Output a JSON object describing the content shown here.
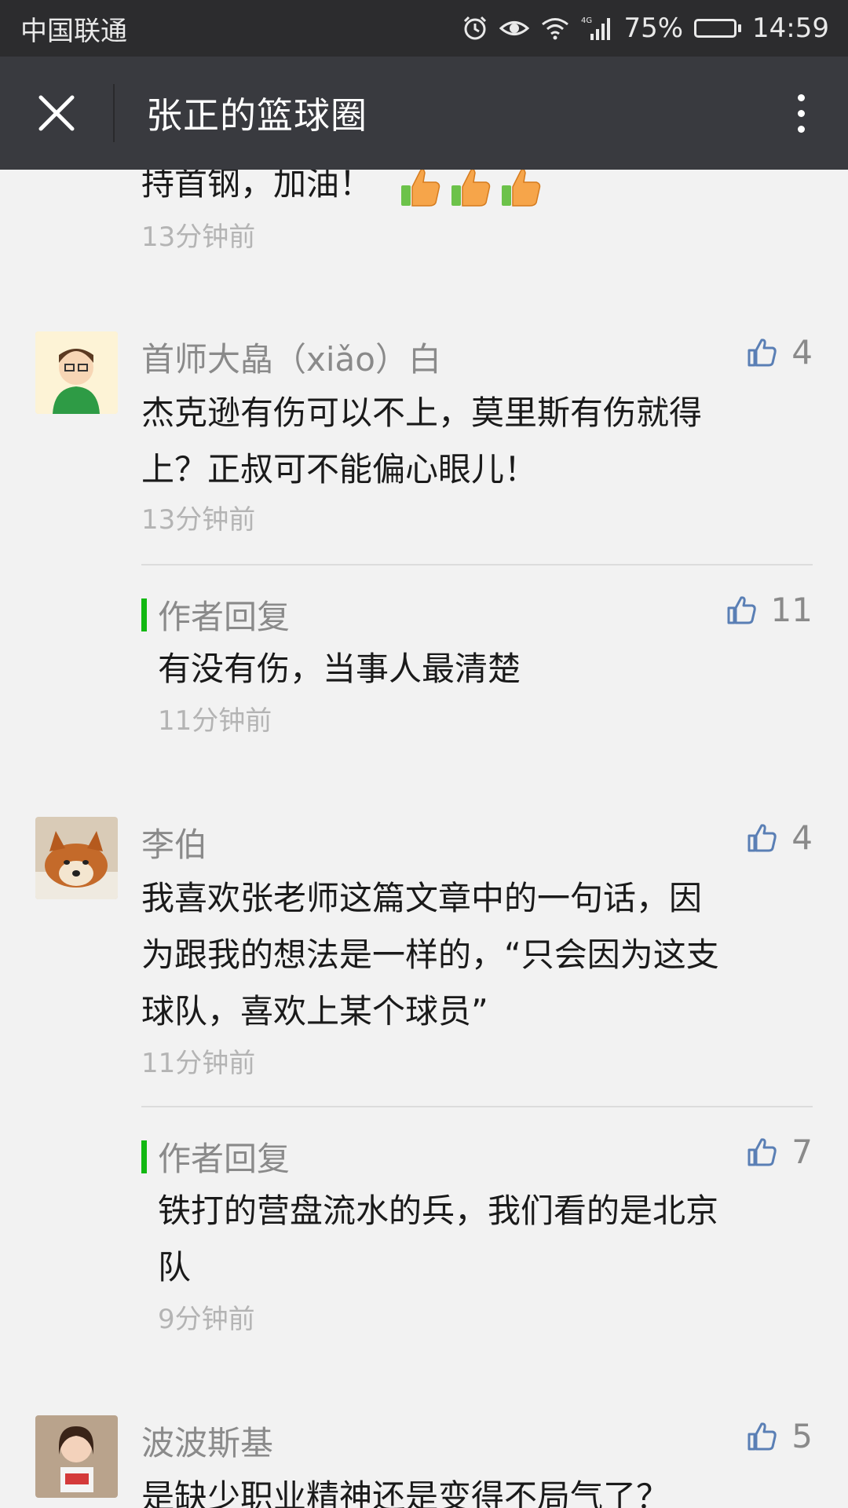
{
  "status_bar": {
    "carrier": "中国联通",
    "network": "4G",
    "battery": "75%",
    "battery_level": 0.75,
    "time": "14:59"
  },
  "header": {
    "title": "张正的篮球圈"
  },
  "partial_comment": {
    "text": "持首钢，加油！",
    "thumbs_emoji_count": 3,
    "time": "13分钟前"
  },
  "comments": [
    {
      "author": "首师大皛（xiǎo）白",
      "likes": "4",
      "line1": "杰克逊有伤可以不上，莫里斯有伤就得",
      "line2": "上？正叔可不能偏心眼儿！",
      "time": "13分钟前",
      "reply": {
        "label": "作者回复",
        "likes": "11",
        "line1": "有没有伤，当事人最清楚",
        "time": "11分钟前"
      }
    },
    {
      "author": "李伯",
      "likes": "4",
      "line1": "我喜欢张老师这篇文章中的一句话，因",
      "line2": "为跟我的想法是一样的，“只会因为这支",
      "line3": "球队，喜欢上某个球员”",
      "time": "11分钟前",
      "reply": {
        "label": "作者回复",
        "likes": "7",
        "line1": "铁打的营盘流水的兵，我们看的是北京",
        "line2": "队",
        "time": "9分钟前"
      }
    },
    {
      "author": "波波斯基",
      "likes": "5",
      "line1": "是缺少职业精神还是变得不局气了？"
    }
  ],
  "colors": {
    "status_bar_bg": "#2c2c2e",
    "title_bar_bg": "#393a3f",
    "page_bg": "#f2f2f2",
    "reply_accent": "#12b812",
    "like_icon": "#5a7fb5"
  }
}
